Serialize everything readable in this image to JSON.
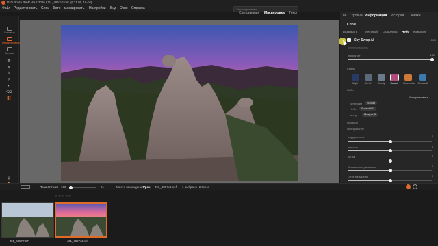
{
  "window": {
    "title": "DxO Photo RAW MAX 2026 (J01_4857v1.nef @ 21.05, 16-bit)"
  },
  "menu": [
    "Файл",
    "Редактировать",
    "Слои",
    "Фото",
    "маскировать",
    "Настройки",
    "Вид",
    "Окно",
    "Справка"
  ],
  "search": {
    "placeholder": "Характеристики"
  },
  "mode_tabs": [
    {
      "label": "Смешивание",
      "active": false
    },
    {
      "label": "Маскировка",
      "active": true
    },
    {
      "label": "Текст",
      "active": false
    }
  ],
  "left_toolbar": {
    "buttons": [
      {
        "label": "Базовые",
        "active": false
      },
      {
        "label": "Редактировать",
        "active": true
      },
      {
        "label": "Больше",
        "active": false
      }
    ]
  },
  "right_panel": {
    "top_tabs": [
      {
        "label": "ве",
        "active": false
      },
      {
        "label": "Уровни",
        "active": false
      },
      {
        "label": "Информация",
        "active": true
      },
      {
        "label": "История",
        "active": false
      },
      {
        "label": "Снимки",
        "active": false
      }
    ],
    "section_title": "Слои",
    "sub_tabs": [
      {
        "label": "развивать",
        "active": false
      },
      {
        "label": "Местный",
        "active": false
      },
      {
        "label": "Эффекты",
        "active": false
      },
      {
        "label": "Небо",
        "active": true
      },
      {
        "label": "Кожаная",
        "active": false
      }
    ],
    "filter_name": "Sky Swap AI",
    "filter_value": "0.00",
    "faint_label": "Интенсивность",
    "opacity_label": "покрытие",
    "opacity_value": "100",
    "opacity_level": 1.0,
    "styles_label": "Стиль",
    "styles": [
      {
        "label": "Night",
        "color": "#2a3a66",
        "active": false
      },
      {
        "label": "Stretch",
        "color": "#5a6a7a",
        "active": false
      },
      {
        "label": "Cloudy",
        "color": "#6a7a8a",
        "active": false
      },
      {
        "label": "Sunset",
        "color": "#b04a7a",
        "active": true
      },
      {
        "label": "Cloudshine",
        "color": "#d07a3a",
        "active": false
      },
      {
        "label": "Большой",
        "color": "#3a7ab0",
        "active": false
      }
    ],
    "sky_label": "Небо",
    "import_button": "Импортировать",
    "sky_fields": [
      {
        "label": "категория",
        "value": "Sunset"
      },
      {
        "label": "Небо",
        "value": "Sunset 022"
      },
      {
        "label": "метод",
        "value": "Модель B"
      }
    ],
    "position_label": "Позиция",
    "corrections_label": "Полирование",
    "sliders": [
      {
        "label": "сардинность",
        "value": "0",
        "level": 0.5
      },
      {
        "label": "яркость",
        "value": "0",
        "level": 0.5
      },
      {
        "label": "Мгла",
        "value": "0",
        "level": 0.5
      },
      {
        "label": "Количество размытия",
        "value": "0",
        "level": 0.5
      },
      {
        "label": "Этот размытия",
        "value": "0",
        "level": 0.5
      }
    ]
  },
  "bottom_bar": {
    "fit_label": "Поместиться",
    "zoom_value": "100",
    "zoom_level": 0.0,
    "page_value": "21",
    "location_label": "Место нахождения",
    "location_value": "Урок",
    "file_value": "J01_4857v1.nef",
    "selection": "1 выбрано -2 всего"
  },
  "filmstrip": {
    "stars": "☆☆☆☆☆",
    "thumbs": [
      {
        "label": "J01_4857.NEF",
        "selected": false
      },
      {
        "label": "J01_4857v1.nef",
        "selected": true
      }
    ]
  },
  "colors": {
    "accent": "#e06a2a",
    "panel": "#262626",
    "canvas": "#686868"
  }
}
